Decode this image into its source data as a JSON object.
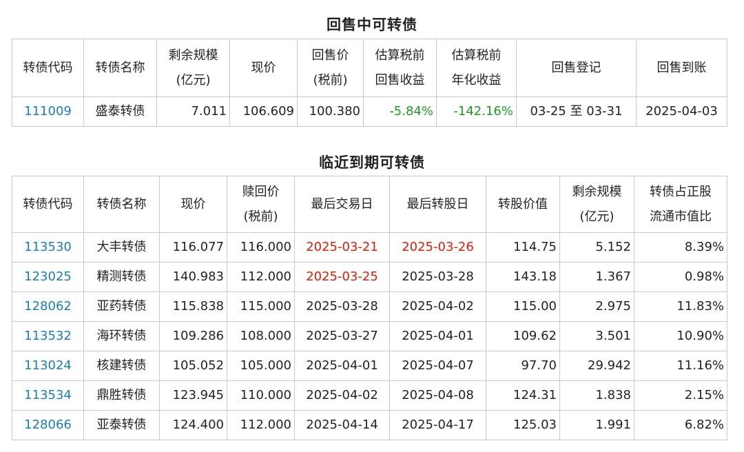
{
  "putback_table": {
    "title": "回售中可转债",
    "headers": [
      [
        "转债代码"
      ],
      [
        "转债名称"
      ],
      [
        "剩余规模",
        "(亿元)"
      ],
      [
        "现价"
      ],
      [
        "回售价",
        "(税前)"
      ],
      [
        "估算税前",
        "回售收益"
      ],
      [
        "估算税前",
        "年化收益"
      ],
      [
        "回售登记"
      ],
      [
        "回售到账"
      ]
    ],
    "rows": [
      {
        "code": "111009",
        "name": "盛泰转债",
        "remaining": "7.011",
        "price": "106.609",
        "putback_price": "100.380",
        "return": "-5.84%",
        "annual_return": "-142.16%",
        "registration": "03-25 至 03-31",
        "settlement": "2025-04-03"
      }
    ]
  },
  "maturity_table": {
    "title": "临近到期可转债",
    "headers": [
      [
        "转债代码"
      ],
      [
        "转债名称"
      ],
      [
        "现价"
      ],
      [
        "赎回价",
        "(税前)"
      ],
      [
        "最后交易日"
      ],
      [
        "最后转股日"
      ],
      [
        "转股价值"
      ],
      [
        "剩余规模",
        "(亿元)"
      ],
      [
        "转债占正股",
        "流通市值比"
      ]
    ],
    "rows": [
      {
        "code": "113530",
        "name": "大丰转债",
        "price": "116.077",
        "redeem": "116.000",
        "last_trade": "2025-03-21",
        "last_convert": "2025-03-26",
        "conv_value": "114.75",
        "remaining": "5.152",
        "ratio": "8.39%"
      },
      {
        "code": "123025",
        "name": "精测转债",
        "price": "140.983",
        "redeem": "112.000",
        "last_trade": "2025-03-25",
        "last_convert": "2025-03-28",
        "conv_value": "143.18",
        "remaining": "1.367",
        "ratio": "0.98%"
      },
      {
        "code": "128062",
        "name": "亚药转债",
        "price": "115.838",
        "redeem": "115.000",
        "last_trade": "2025-03-28",
        "last_convert": "2025-04-02",
        "conv_value": "115.00",
        "remaining": "2.975",
        "ratio": "11.83%"
      },
      {
        "code": "113532",
        "name": "海环转债",
        "price": "109.286",
        "redeem": "108.000",
        "last_trade": "2025-03-27",
        "last_convert": "2025-04-01",
        "conv_value": "109.62",
        "remaining": "3.501",
        "ratio": "10.90%"
      },
      {
        "code": "113024",
        "name": "核建转债",
        "price": "105.052",
        "redeem": "105.000",
        "last_trade": "2025-04-01",
        "last_convert": "2025-04-07",
        "conv_value": "97.70",
        "remaining": "29.942",
        "ratio": "11.16%"
      },
      {
        "code": "113534",
        "name": "鼎胜转债",
        "price": "123.945",
        "redeem": "110.000",
        "last_trade": "2025-04-02",
        "last_convert": "2025-04-08",
        "conv_value": "124.31",
        "remaining": "1.838",
        "ratio": "2.15%"
      },
      {
        "code": "128066",
        "name": "亚泰转债",
        "price": "124.400",
        "redeem": "112.000",
        "last_trade": "2025-04-14",
        "last_convert": "2025-04-17",
        "conv_value": "125.03",
        "remaining": "1.991",
        "ratio": "6.82%"
      }
    ],
    "highlight": [
      {
        "row": 0,
        "field": "last_trade"
      },
      {
        "row": 0,
        "field": "last_convert"
      },
      {
        "row": 1,
        "field": "last_trade"
      }
    ]
  },
  "colors": {
    "code_link": "#1a7db8",
    "negative_return": "#1f9b1f",
    "date_alert": "#d81e06",
    "border": "#c9c9c9"
  }
}
